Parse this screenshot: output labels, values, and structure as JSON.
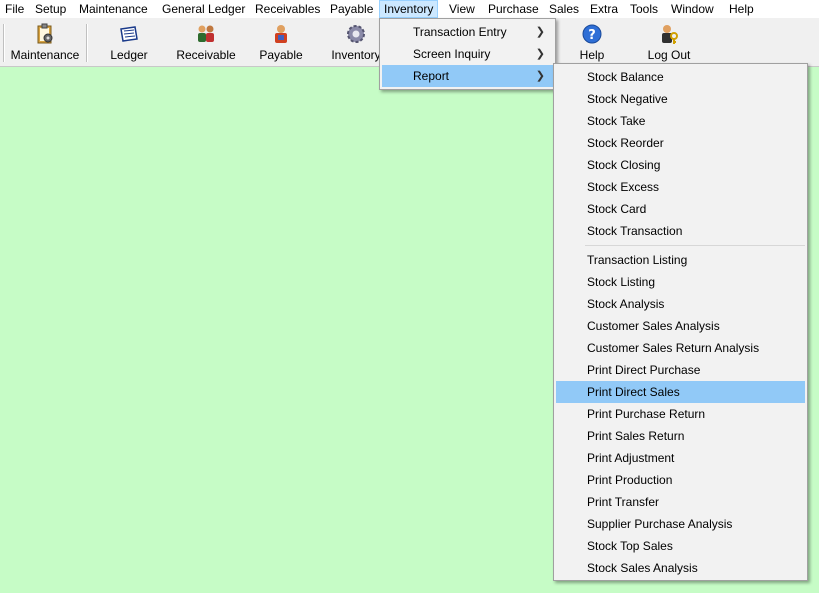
{
  "menubar": [
    "File",
    "Setup",
    "Maintenance",
    "General Ledger",
    "Receivables",
    "Payable",
    "Inventory",
    "View",
    "Purchase",
    "Sales",
    "Extra",
    "Tools",
    "Window",
    "Help"
  ],
  "menubar_active": "Inventory",
  "toolbar": {
    "maintenance": "Maintenance",
    "ledger": "Ledger",
    "receivable": "Receivable",
    "payable": "Payable",
    "inventory": "Inventory",
    "help": "Help",
    "logout": "Log Out"
  },
  "inventory_menu": [
    "Transaction Entry",
    "Screen Inquiry",
    "Report"
  ],
  "inventory_menu_selected": "Report",
  "report_menu": {
    "group1": [
      "Stock Balance",
      "Stock Negative",
      "Stock Take",
      "Stock Reorder",
      "Stock Closing",
      "Stock Excess",
      "Stock Card",
      "Stock Transaction"
    ],
    "group2": [
      "Transaction Listing",
      "Stock Listing",
      "Stock Analysis",
      "Customer Sales Analysis",
      "Customer Sales Return Analysis",
      "Print Direct Purchase",
      "Print Direct Sales",
      "Print Purchase Return",
      "Print Sales Return",
      "Print Adjustment",
      "Print Production",
      "Print Transfer",
      "Supplier Purchase Analysis",
      "Stock Top Sales",
      "Stock Sales Analysis"
    ]
  },
  "report_menu_selected": "Print Direct Sales",
  "icons": {
    "maintenance": "clipboard-gear-icon",
    "ledger": "ledger-book-icon",
    "receivable": "people-icon",
    "payable": "payable-icon",
    "inventory": "gear-icon",
    "help": "help-icon",
    "logout": "key-person-icon",
    "submenu": "chevron-right-icon"
  },
  "colors": {
    "background": "#c6fcc6",
    "menu_highlight": "#91c9f7",
    "menubar_active": "#cce8ff"
  }
}
